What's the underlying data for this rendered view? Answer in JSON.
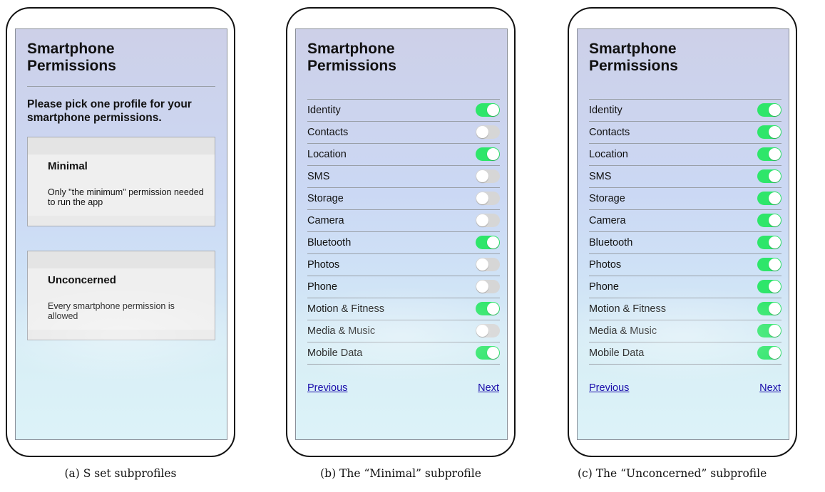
{
  "phone_a": {
    "title": "Smartphone Permissions",
    "prompt": "Please pick one profile for your smartphone permissions.",
    "profiles": [
      {
        "name": "Minimal",
        "description": "Only \"the minimum\" permission needed to run the app"
      },
      {
        "name": "Unconcerned",
        "description": "Every smartphone permission is allowed"
      }
    ]
  },
  "phone_b": {
    "title": "Smartphone Permissions",
    "permissions": [
      {
        "label": "Identity",
        "enabled": true
      },
      {
        "label": "Contacts",
        "enabled": false
      },
      {
        "label": "Location",
        "enabled": true
      },
      {
        "label": "SMS",
        "enabled": false
      },
      {
        "label": "Storage",
        "enabled": false
      },
      {
        "label": "Camera",
        "enabled": false
      },
      {
        "label": "Bluetooth",
        "enabled": true
      },
      {
        "label": "Photos",
        "enabled": false
      },
      {
        "label": "Phone",
        "enabled": false
      },
      {
        "label": "Motion & Fitness",
        "enabled": true
      },
      {
        "label": "Media & Music",
        "enabled": false
      },
      {
        "label": "Mobile Data",
        "enabled": true
      }
    ],
    "previous_label": "Previous",
    "next_label": "Next"
  },
  "phone_c": {
    "title": "Smartphone Permissions",
    "permissions": [
      {
        "label": "Identity",
        "enabled": true
      },
      {
        "label": "Contacts",
        "enabled": true
      },
      {
        "label": "Location",
        "enabled": true
      },
      {
        "label": "SMS",
        "enabled": true
      },
      {
        "label": "Storage",
        "enabled": true
      },
      {
        "label": "Camera",
        "enabled": true
      },
      {
        "label": "Bluetooth",
        "enabled": true
      },
      {
        "label": "Photos",
        "enabled": true
      },
      {
        "label": "Phone",
        "enabled": true
      },
      {
        "label": "Motion & Fitness",
        "enabled": true
      },
      {
        "label": "Media & Music",
        "enabled": true
      },
      {
        "label": "Mobile Data",
        "enabled": true
      }
    ],
    "previous_label": "Previous",
    "next_label": "Next"
  },
  "captions": [
    "(a) S set subprofiles",
    "(b) The “Minimal” subprofile",
    "(c) The “Unconcerned” subprofile"
  ],
  "colors": {
    "toggle_on": "#2ee66a",
    "toggle_off": "#d6d6d6",
    "link": "#1a0dab"
  }
}
